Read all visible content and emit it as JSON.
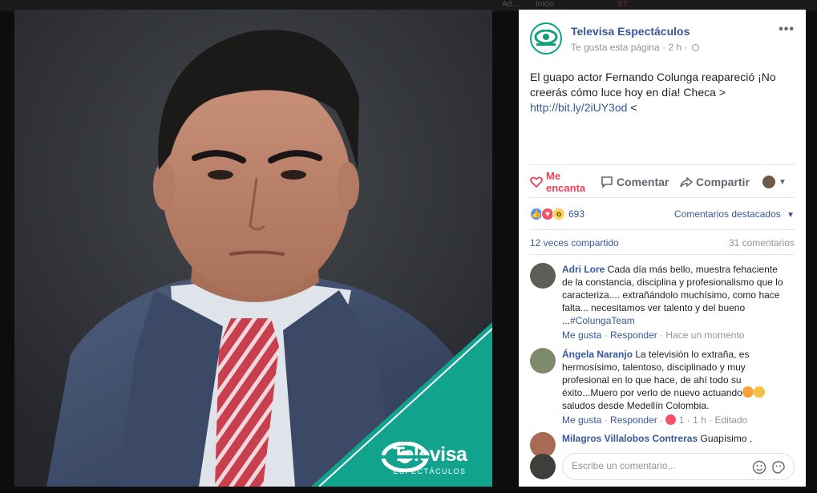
{
  "top_bar": {
    "left_text": "Ad...",
    "right_text": "Inicio",
    "badge": "ST"
  },
  "photo": {
    "brand_name": "Televisa",
    "brand_sub": "ESPECTÁCULOS",
    "colors": {
      "background": "#2e3136",
      "teal": "#12a38e"
    }
  },
  "post": {
    "page_name": "Televisa Espectáculos",
    "liked_text": "Te gusta esta página",
    "time": "2 h",
    "privacy_icon": "globe-icon",
    "body_text": "El guapo actor Fernando Colunga reapareció ¡No creerás cómo luce hoy en día! Checa > ",
    "link_text": "http://bit.ly/2iUY3od",
    "after_link": " <"
  },
  "actions": {
    "love_label": "Me encanta",
    "comment_label": "Comentar",
    "share_label": "Compartir"
  },
  "reactions": {
    "count": "693",
    "featured_label": "Comentarios destacados",
    "shares": "12 veces compartido",
    "comments_count": "31 comentarios"
  },
  "comments": [
    {
      "name": "Adri Lore",
      "text": " Cada día más bello, muestra fehaciente de la constancia, disciplina y profesionalismo que lo caracteriza.... extrañándolo muchísimo, como hace falta... necesitamos ver talento y del bueno ...",
      "tag": "#ColungaTeam",
      "like": "Me gusta",
      "reply": "Responder",
      "time": "Hace un momento"
    },
    {
      "name": "Ángela Naranjo",
      "text": " La televisión lo extraña, es hermosísimo, talentoso, disciplinado y muy profesional en lo que hace, de ahí todo su éxito...Muero por verlo de nuevo actuando",
      "text2": " saludos desde Medellín Colombia.",
      "like": "Me gusta",
      "reply": "Responder",
      "reactions": "1",
      "time": "1 h",
      "edited": "Editado"
    },
    {
      "name": "Milagros Villalobos Contreras",
      "text": " Guapísimo ,"
    }
  ],
  "composer": {
    "placeholder": "Escribe un comentario..."
  },
  "colors": {
    "link": "#365899",
    "love": "#f33e58",
    "muted": "#90949c"
  }
}
